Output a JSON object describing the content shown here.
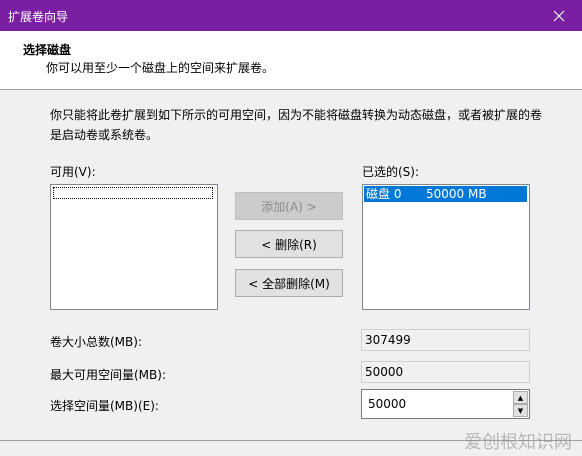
{
  "window": {
    "title": "扩展卷向导"
  },
  "header": {
    "title": "选择磁盘",
    "subtitle": "你可以用至少一个磁盘上的空间来扩展卷。"
  },
  "description": "你只能将此卷扩展到如下所示的可用空间，因为不能将磁盘转换为动态磁盘，或者被扩展的卷是启动卷或系统卷。",
  "available": {
    "label": "可用(V):"
  },
  "selected": {
    "label": "已选的(S):",
    "items": [
      {
        "disk": "磁盘 0",
        "size": "50000 MB"
      }
    ]
  },
  "buttons": {
    "add": "添加(A) >",
    "remove": "< 删除(R)",
    "remove_all": "< 全部删除(M)"
  },
  "fields": {
    "total_size_label": "卷大小总数(MB):",
    "total_size_value": "307499",
    "max_space_label": "最大可用空间量(MB):",
    "max_space_value": "50000",
    "select_space_label": "选择空间量(MB)(E):",
    "select_space_value": "50000"
  },
  "watermark": "爱创根知识网",
  "colors": {
    "titlebar": "#7b1fa2",
    "selection": "#0078d7"
  }
}
